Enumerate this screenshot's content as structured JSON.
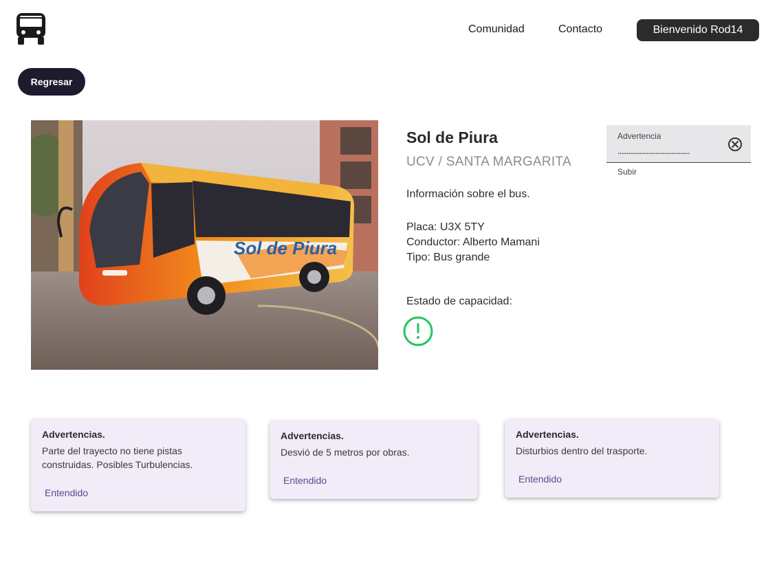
{
  "header": {
    "logo_icon": "bus-icon",
    "nav": [
      {
        "label": "Comunidad"
      },
      {
        "label": "Contacto"
      }
    ],
    "welcome_label": "Bienvenido Rod14"
  },
  "back_button_label": "Regresar",
  "bus": {
    "photo_text": "Sol de Piura",
    "name": "Sol de Piura",
    "route": "UCV / SANTA MARGARITA",
    "info": "Información sobre el bus.",
    "plate": "Placa: U3X 5TY",
    "driver": "Conductor: Alberto Mamani",
    "type": "Tipo: Bus grande",
    "capacity_label": "Estado de capacidad:",
    "capacity_icon": "alert-circle-icon",
    "capacity_color": "#22c55e"
  },
  "warning_form": {
    "label": "Advertencia",
    "value": "........................................",
    "clear_icon": "clear-circle-icon",
    "submit_label": "Subir"
  },
  "warnings": [
    {
      "title": "Advertencias.",
      "text": "Parte del trayecto no tiene pistas construidas. Posibles Turbulencias.",
      "action": "Entendido"
    },
    {
      "title": "Advertencias.",
      "text": "Desvió de 5 metros por obras.",
      "action": "Entendido"
    },
    {
      "title": "Advertencias.",
      "text": "Disturbios dentro del trasporte.",
      "action": "Entendido"
    }
  ],
  "colors": {
    "accent_dark": "#1d1b2e",
    "card_bg": "#f1ecf8",
    "card_action": "#5b4a8a"
  }
}
